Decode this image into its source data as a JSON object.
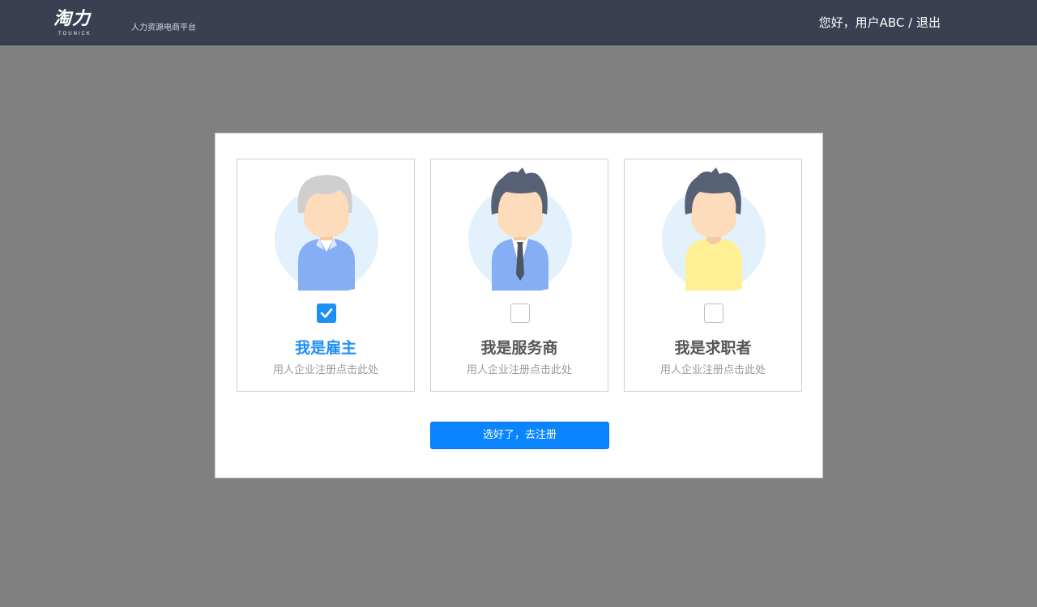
{
  "header": {
    "logo_text": "淘力",
    "logo_subtext": "TOUNICK",
    "slogan": "人力资源电商平台",
    "greeting": "您好，用户ABC",
    "separator": " / ",
    "logout_label": "退出"
  },
  "roles": [
    {
      "title": "我是雇主",
      "desc": "用人企业注册点击此处",
      "selected": true,
      "avatar": "employer-avatar-icon"
    },
    {
      "title": "我是服务商",
      "desc": "用人企业注册点击此处",
      "selected": false,
      "avatar": "service-provider-avatar-icon"
    },
    {
      "title": "我是求职者",
      "desc": "用人企业注册点击此处",
      "selected": false,
      "avatar": "job-seeker-avatar-icon"
    }
  ],
  "submit_label": "选好了，去注册",
  "colors": {
    "topbar": "#3a3f52",
    "accent": "#0a84ff",
    "overlay": "#808080",
    "avatar_bg": "#e3f1fd"
  }
}
